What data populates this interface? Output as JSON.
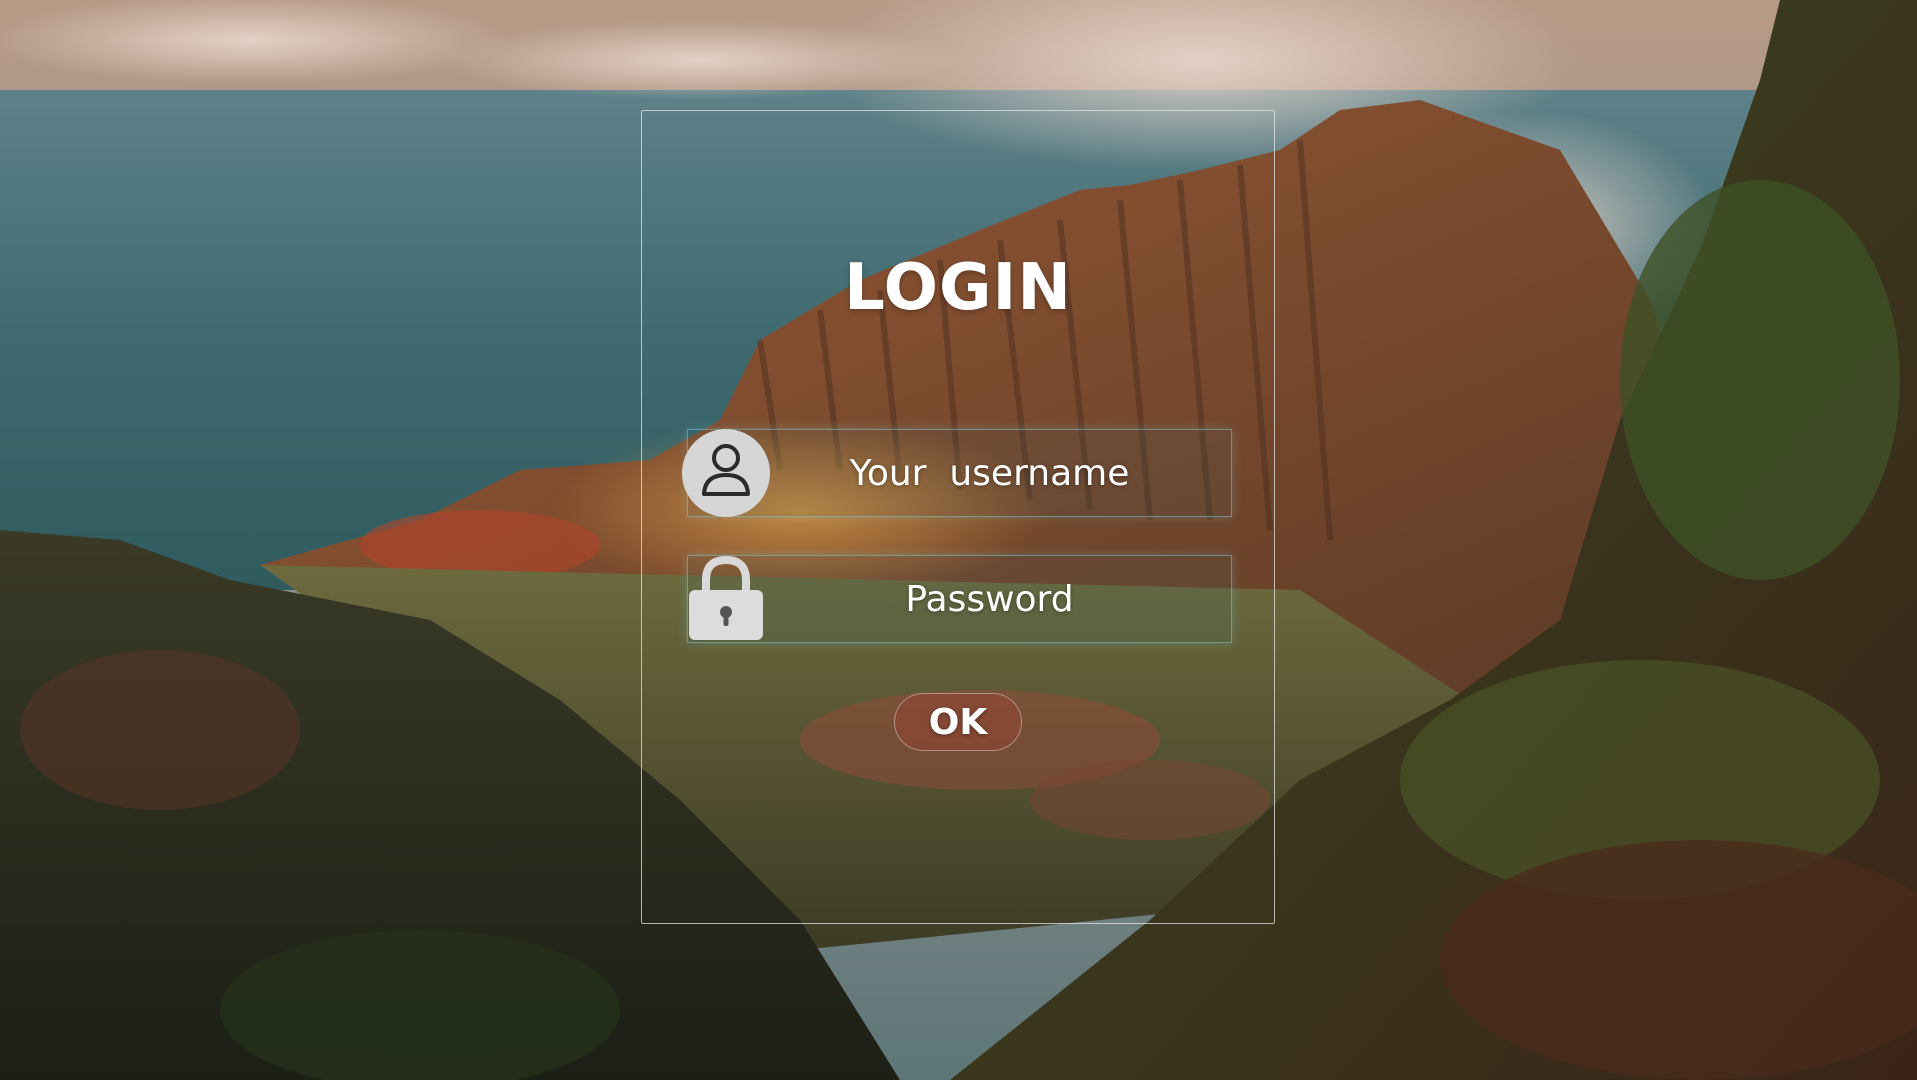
{
  "login": {
    "title": "LOGIN",
    "username_placeholder": "Your  username",
    "password_placeholder": "Password",
    "ok_label": "OK"
  },
  "icons": {
    "username": "user-icon",
    "password": "lock-icon"
  },
  "colors": {
    "text": "#ffffff",
    "panel_border": "#e6e6e6",
    "field_border": "#78c8d7",
    "ok_tint": "#aa3c32"
  }
}
